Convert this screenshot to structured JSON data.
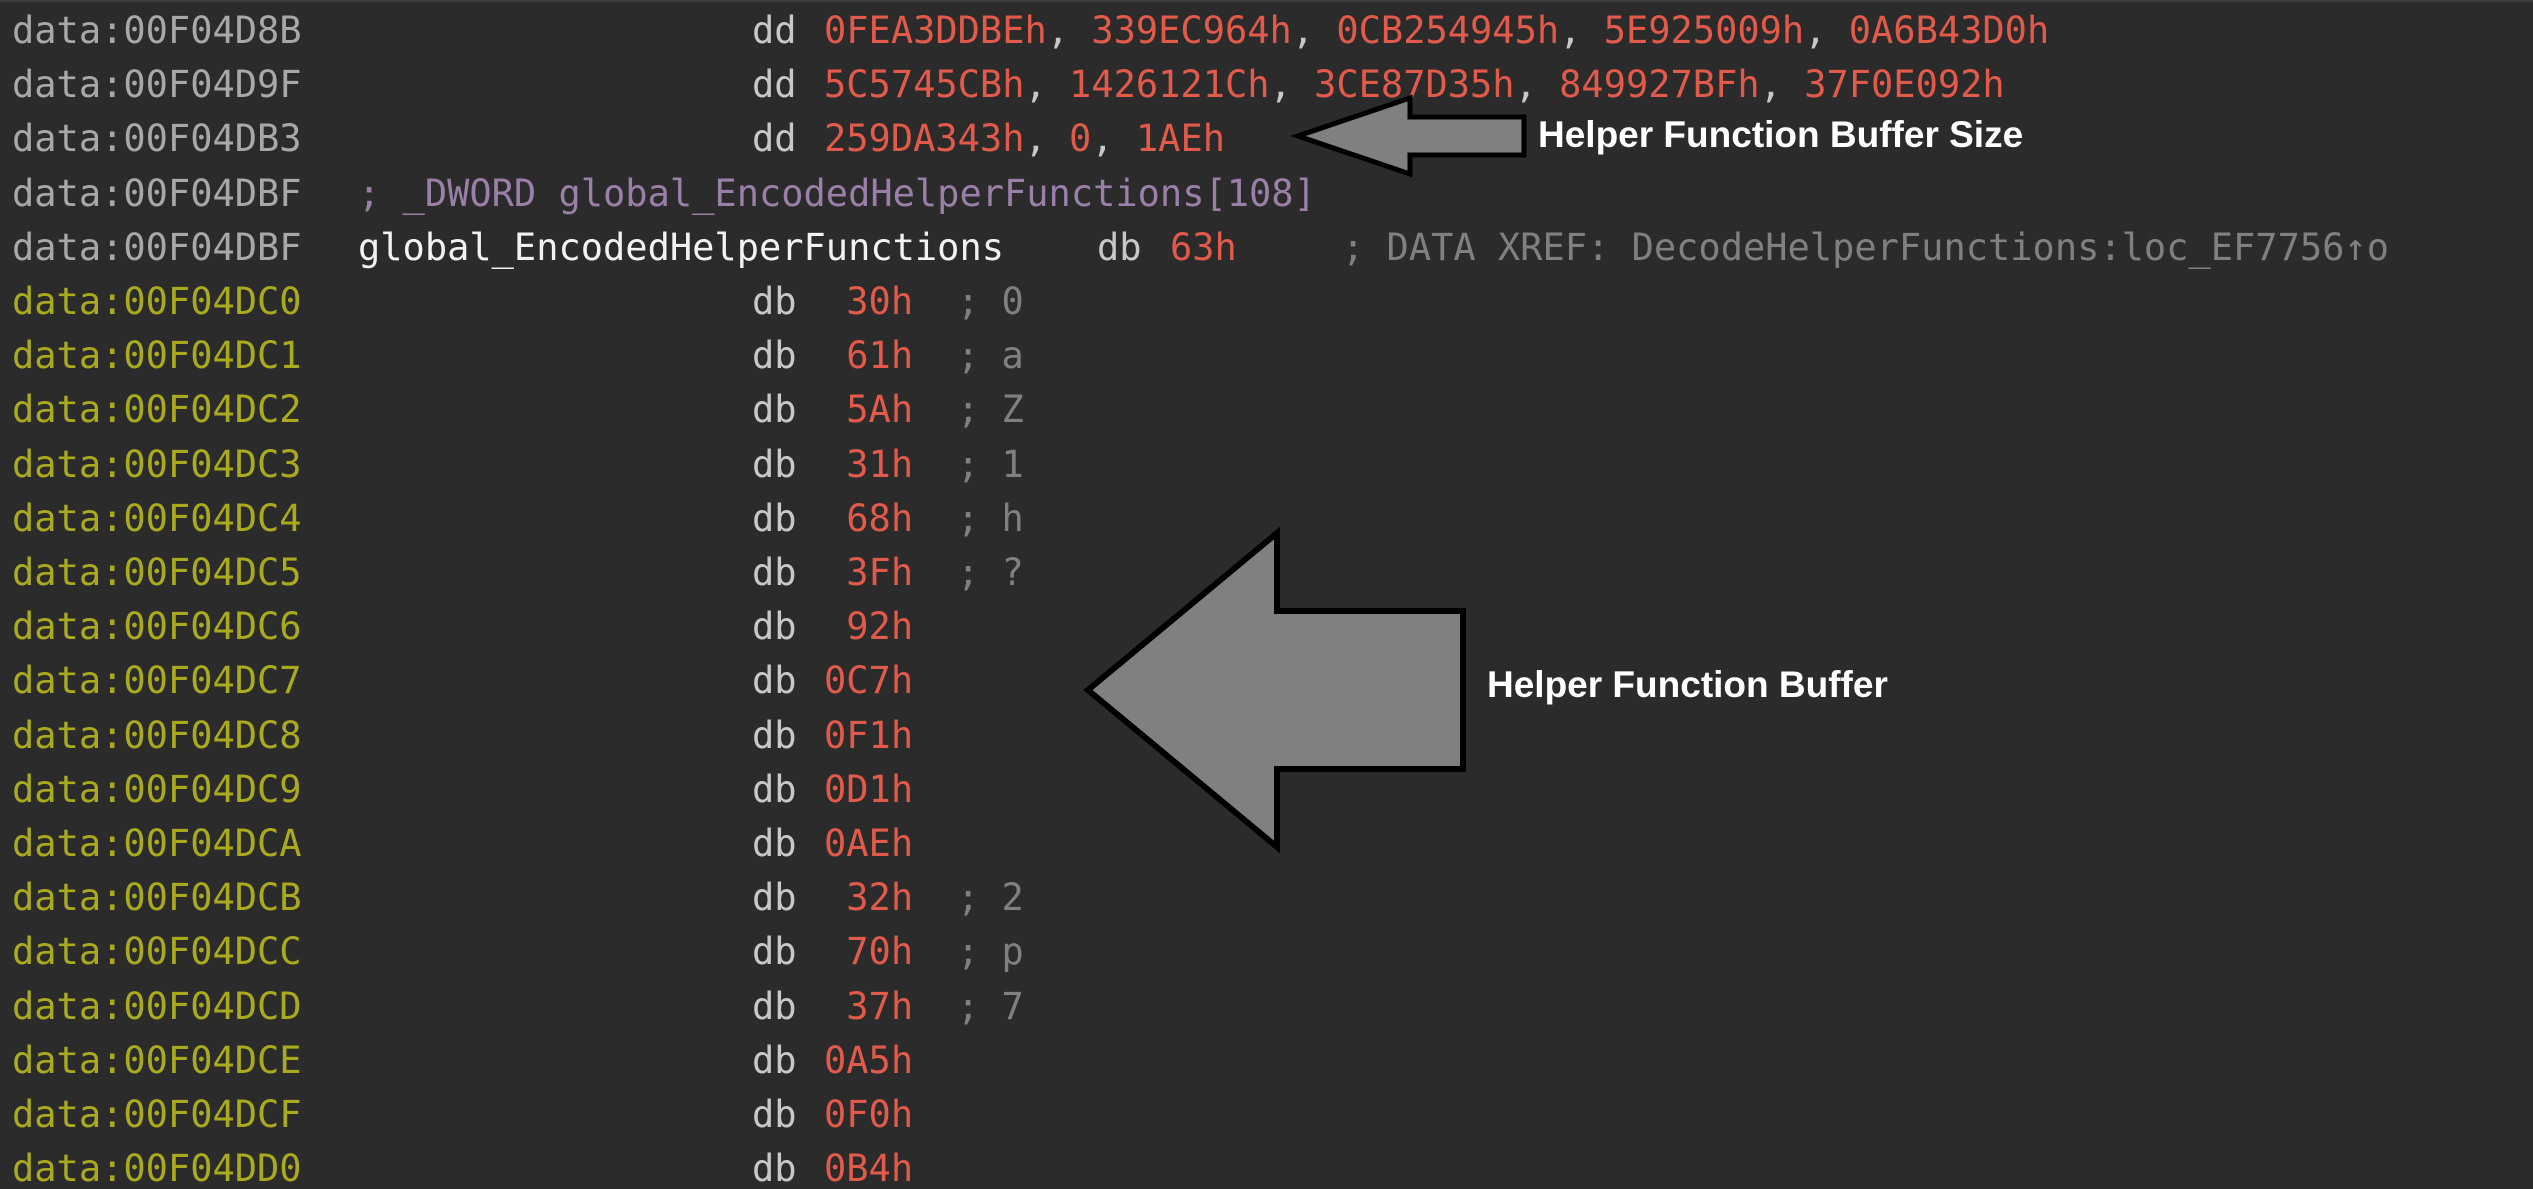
{
  "header_rows": [
    {
      "address": "data:00F04D8B",
      "mnemonic": "dd",
      "operands": [
        "0FEA3DDBEh",
        "339EC964h",
        "0CB254945h",
        "5E925009h",
        "0A6B43D0h"
      ]
    },
    {
      "address": "data:00F04D9F",
      "mnemonic": "dd",
      "operands": [
        "5C5745CBh",
        "1426121Ch",
        "3CE87D35h",
        "849927BFh",
        "37F0E092h"
      ]
    },
    {
      "address": "data:00F04DB3",
      "mnemonic": "dd",
      "operands": [
        "259DA343h",
        "0",
        "1AEh"
      ]
    }
  ],
  "declaration": {
    "address": "data:00F04DBF",
    "comment": "; _DWORD global_EncodedHelperFunctions[108]"
  },
  "global_row": {
    "address": "data:00F04DBF",
    "name": "global_EncodedHelperFunctions",
    "mnemonic": "db",
    "value": "63h",
    "xref": "; DATA XREF: DecodeHelperFunctions:loc_EF7756↑o"
  },
  "byte_rows": [
    {
      "address": "data:00F04DC0",
      "mnemonic": "db",
      "value": " 30h",
      "comment": "; 0"
    },
    {
      "address": "data:00F04DC1",
      "mnemonic": "db",
      "value": " 61h",
      "comment": "; a"
    },
    {
      "address": "data:00F04DC2",
      "mnemonic": "db",
      "value": " 5Ah",
      "comment": "; Z"
    },
    {
      "address": "data:00F04DC3",
      "mnemonic": "db",
      "value": " 31h",
      "comment": "; 1"
    },
    {
      "address": "data:00F04DC4",
      "mnemonic": "db",
      "value": " 68h",
      "comment": "; h"
    },
    {
      "address": "data:00F04DC5",
      "mnemonic": "db",
      "value": " 3Fh",
      "comment": "; ?"
    },
    {
      "address": "data:00F04DC6",
      "mnemonic": "db",
      "value": " 92h",
      "comment": ""
    },
    {
      "address": "data:00F04DC7",
      "mnemonic": "db",
      "value": "0C7h",
      "comment": ""
    },
    {
      "address": "data:00F04DC8",
      "mnemonic": "db",
      "value": "0F1h",
      "comment": ""
    },
    {
      "address": "data:00F04DC9",
      "mnemonic": "db",
      "value": "0D1h",
      "comment": ""
    },
    {
      "address": "data:00F04DCA",
      "mnemonic": "db",
      "value": "0AEh",
      "comment": ""
    },
    {
      "address": "data:00F04DCB",
      "mnemonic": "db",
      "value": " 32h",
      "comment": "; 2"
    },
    {
      "address": "data:00F04DCC",
      "mnemonic": "db",
      "value": " 70h",
      "comment": "; p"
    },
    {
      "address": "data:00F04DCD",
      "mnemonic": "db",
      "value": " 37h",
      "comment": "; 7"
    },
    {
      "address": "data:00F04DCE",
      "mnemonic": "db",
      "value": "0A5h",
      "comment": ""
    },
    {
      "address": "data:00F04DCF",
      "mnemonic": "db",
      "value": "0F0h",
      "comment": ""
    },
    {
      "address": "data:00F04DD0",
      "mnemonic": "db",
      "value": "0B4h",
      "comment": ""
    }
  ],
  "annotations": {
    "buffer_size_label": "Helper Function Buffer Size",
    "buffer_label": "Helper Function Buffer"
  },
  "colors": {
    "background": "#2b2b2b",
    "data_address": "#a8a8a8",
    "code_address": "#aaaa1f",
    "operand": "#e25a4a",
    "comment": "#808080",
    "arrow_fill": "#808080"
  }
}
